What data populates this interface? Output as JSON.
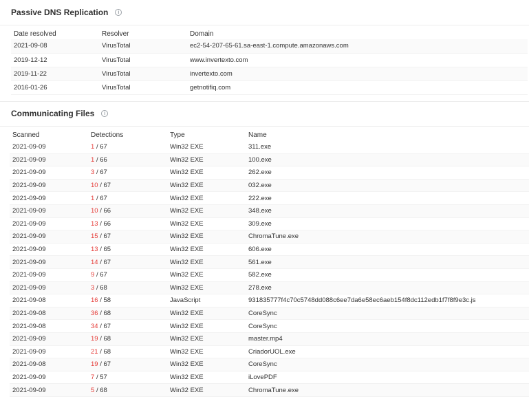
{
  "dns": {
    "title": "Passive DNS Replication",
    "columns": [
      "Date resolved",
      "Resolver",
      "Domain"
    ],
    "rows": [
      {
        "date": "2021-09-08",
        "resolver": "VirusTotal",
        "domain": "ec2-54-207-65-61.sa-east-1.compute.amazonaws.com"
      },
      {
        "date": "2019-12-12",
        "resolver": "VirusTotal",
        "domain": "www.invertexto.com"
      },
      {
        "date": "2019-11-22",
        "resolver": "VirusTotal",
        "domain": "invertexto.com"
      },
      {
        "date": "2016-01-26",
        "resolver": "VirusTotal",
        "domain": "getnotifiq.com"
      }
    ]
  },
  "files": {
    "title": "Communicating Files",
    "columns": [
      "Scanned",
      "Detections",
      "Type",
      "Name"
    ],
    "rows": [
      {
        "scanned": "2021-09-09",
        "positives": "1",
        "total": "/ 67",
        "type": "Win32 EXE",
        "name": "311.exe"
      },
      {
        "scanned": "2021-09-09",
        "positives": "1",
        "total": "/ 66",
        "type": "Win32 EXE",
        "name": "100.exe"
      },
      {
        "scanned": "2021-09-09",
        "positives": "3",
        "total": "/ 67",
        "type": "Win32 EXE",
        "name": "262.exe"
      },
      {
        "scanned": "2021-09-09",
        "positives": "10",
        "total": "/ 67",
        "type": "Win32 EXE",
        "name": "032.exe"
      },
      {
        "scanned": "2021-09-09",
        "positives": "1",
        "total": "/ 67",
        "type": "Win32 EXE",
        "name": "222.exe"
      },
      {
        "scanned": "2021-09-09",
        "positives": "10",
        "total": "/ 66",
        "type": "Win32 EXE",
        "name": "348.exe"
      },
      {
        "scanned": "2021-09-09",
        "positives": "13",
        "total": "/ 66",
        "type": "Win32 EXE",
        "name": "309.exe"
      },
      {
        "scanned": "2021-09-09",
        "positives": "15",
        "total": "/ 67",
        "type": "Win32 EXE",
        "name": "ChromaTune.exe"
      },
      {
        "scanned": "2021-09-09",
        "positives": "13",
        "total": "/ 65",
        "type": "Win32 EXE",
        "name": "606.exe"
      },
      {
        "scanned": "2021-09-09",
        "positives": "14",
        "total": "/ 67",
        "type": "Win32 EXE",
        "name": "561.exe"
      },
      {
        "scanned": "2021-09-09",
        "positives": "9",
        "total": "/ 67",
        "type": "Win32 EXE",
        "name": "582.exe"
      },
      {
        "scanned": "2021-09-09",
        "positives": "3",
        "total": "/ 68",
        "type": "Win32 EXE",
        "name": "278.exe"
      },
      {
        "scanned": "2021-09-08",
        "positives": "16",
        "total": "/ 58",
        "type": "JavaScript",
        "name": "931835777f4c70c5748dd088c6ee7da6e58ec6aeb154f8dc112edb1f7f8f9e3c.js"
      },
      {
        "scanned": "2021-09-08",
        "positives": "36",
        "total": "/ 68",
        "type": "Win32 EXE",
        "name": "CoreSync"
      },
      {
        "scanned": "2021-09-08",
        "positives": "34",
        "total": "/ 67",
        "type": "Win32 EXE",
        "name": "CoreSync"
      },
      {
        "scanned": "2021-09-09",
        "positives": "19",
        "total": "/ 68",
        "type": "Win32 EXE",
        "name": "master.mp4"
      },
      {
        "scanned": "2021-09-09",
        "positives": "21",
        "total": "/ 68",
        "type": "Win32 EXE",
        "name": "CriadorUOL.exe"
      },
      {
        "scanned": "2021-09-08",
        "positives": "19",
        "total": "/ 67",
        "type": "Win32 EXE",
        "name": "CoreSync"
      },
      {
        "scanned": "2021-09-09",
        "positives": "7",
        "total": "/ 57",
        "type": "Win32 EXE",
        "name": "iLovePDF"
      },
      {
        "scanned": "2021-09-09",
        "positives": "5",
        "total": "/ 68",
        "type": "Win32 EXE",
        "name": "ChromaTune.exe"
      }
    ]
  },
  "colors": {
    "detection_positive": "#e53935",
    "text": "#313131",
    "border": "#ececec"
  },
  "icons": {
    "info": "info-circle-icon"
  }
}
